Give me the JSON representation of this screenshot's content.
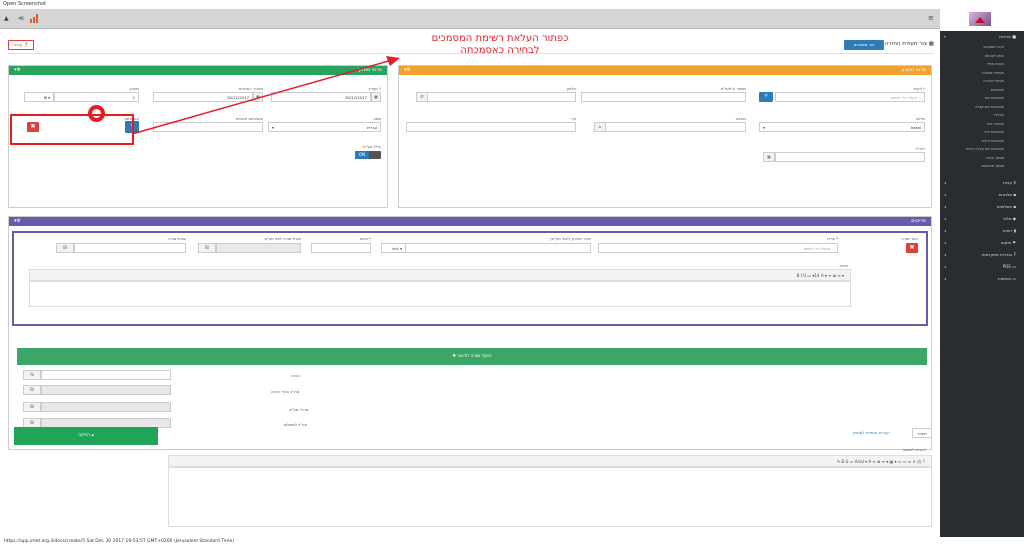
{
  "window_title": "Open Screenshot",
  "status_url": "https://app.imet.org.il/docs/create/5 Sat Dec 30 2017 19:53:57 GMT+0200 (Jerusalem Standard Time)",
  "annotation": {
    "line1": "כפתור העלאת רשימת המסמכים",
    "line2": "לבחירה כאסמכתה"
  },
  "header": {
    "title": "צור תעודת החזרה",
    "docs_button": "צור מסמכים",
    "help_button": "עזרה"
  },
  "sidebar": {
    "items": [
      {
        "label": "מכירות",
        "expanded": true
      },
      {
        "label": "קניות"
      },
      {
        "label": "מלגזנות"
      },
      {
        "label": "תשלומים"
      },
      {
        "label": "מלאי"
      },
      {
        "label": "דוחות"
      },
      {
        "label": "מיקום"
      },
      {
        "label": "הגדרות מתקדמות"
      },
      {
        "label": "POS"
      },
      {
        "label": "משימות"
      }
    ],
    "sub_items": [
      "ניהול מסמכים",
      "הזמן לקוחות",
      "הצעת מחיר",
      "תעודות משלוח",
      "תעודת החזרה",
      "חשבוניות",
      "חשבוניות מס",
      "חשבוניות מס-קבלה",
      "קבלות",
      "תעודות זיכוי",
      "חשבוניות זיכוי",
      "חשבוניות ידניות",
      "חשבוניות מס קבלה ידניות",
      "מסמך טיוטה",
      "מסמך ממוחשב"
    ]
  },
  "customer_panel": {
    "title": "פרטי חשבון",
    "customer_label": "לקוח *",
    "customer_placeholder": "הקלד כדי לחפש...",
    "vat_label": "מספר ע\"מ/ח\"פ",
    "phone_label": "טלפון",
    "country_label": "מדינה",
    "country_value": "Israel",
    "address_label": "כתובת",
    "city_label": "עיר",
    "email_label": "דוא\"ל"
  },
  "doc_panel": {
    "title": "פרטי מסמך",
    "date_label": "תאריך *",
    "date_value": "30/12/2017",
    "due_label": "תאריך התחדות",
    "due_value": "30/12/2017",
    "currency_label": "מטבע",
    "currency_value": "1",
    "currency_code": "₪",
    "asmachta_label": "אסמכתא",
    "external_label": "אסמכתא חיצונית",
    "language_label": "שפה",
    "language_value": "עברית",
    "include_vat_label": "כולל מע\"מ",
    "toggle_value": "ON"
  },
  "items_panel": {
    "title": "פריטים",
    "remove_row_label": "הסר שורה",
    "item_label": "פריט *",
    "item_placeholder": "הקלד כדי לחפש...",
    "price_label": "מחיר מחירון (לפני מע\"מ)",
    "price_suffix": "לפני",
    "qty_label": "כמות *",
    "discount_label": "שורת שורה לפני מע\"מ",
    "total_label": "שורת שורה",
    "description_label": "תיאור",
    "currency_symbol": "₪",
    "add_row": "הוסף שורה חדשה"
  },
  "totals": {
    "discount_label": "הנחה",
    "discount_value": "%",
    "subtotal_label": "סה\"כ אחרי הנחה",
    "vat_label": "סה\"כ מע\"מ",
    "total_label": "סה\"כ לתשלום",
    "currency": "₪"
  },
  "notes": {
    "tab1": "תיאור",
    "tab2": "הערות נוספות למסמך",
    "notes_label": "הערות למסמך",
    "font_value": "Arial"
  },
  "submit_button": "הפקה"
}
